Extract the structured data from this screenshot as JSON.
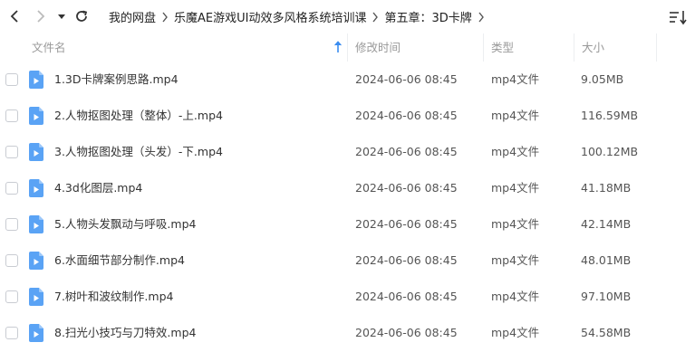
{
  "toolbar": {
    "breadcrumb": [
      "我的网盘",
      "乐魔AE游戏UI动效多风格系统培训课",
      "第五章：3D卡牌"
    ]
  },
  "columns": {
    "name": "文件名",
    "modified": "修改时间",
    "type": "类型",
    "size": "大小"
  },
  "colors": {
    "accent": "#3b8df0",
    "file_icon": "#5aa3f5"
  },
  "files": [
    {
      "name": "1.3D卡牌案例思路.mp4",
      "modified": "2024-06-06 08:45",
      "type": "mp4文件",
      "size": "9.05MB"
    },
    {
      "name": "2.人物抠图处理（整体）-上.mp4",
      "modified": "2024-06-06 08:45",
      "type": "mp4文件",
      "size": "116.59MB"
    },
    {
      "name": "3.人物抠图处理（头发）-下.mp4",
      "modified": "2024-06-06 08:45",
      "type": "mp4文件",
      "size": "100.12MB"
    },
    {
      "name": "4.3d化图层.mp4",
      "modified": "2024-06-06 08:45",
      "type": "mp4文件",
      "size": "41.18MB"
    },
    {
      "name": "5.人物头发飘动与呼吸.mp4",
      "modified": "2024-06-06 08:45",
      "type": "mp4文件",
      "size": "42.14MB"
    },
    {
      "name": "6.水面细节部分制作.mp4",
      "modified": "2024-06-06 08:45",
      "type": "mp4文件",
      "size": "48.01MB"
    },
    {
      "name": "7.树叶和波纹制作.mp4",
      "modified": "2024-06-06 08:45",
      "type": "mp4文件",
      "size": "97.10MB"
    },
    {
      "name": "8.扫光小技巧与刀特效.mp4",
      "modified": "2024-06-06 08:45",
      "type": "mp4文件",
      "size": "54.58MB"
    }
  ]
}
